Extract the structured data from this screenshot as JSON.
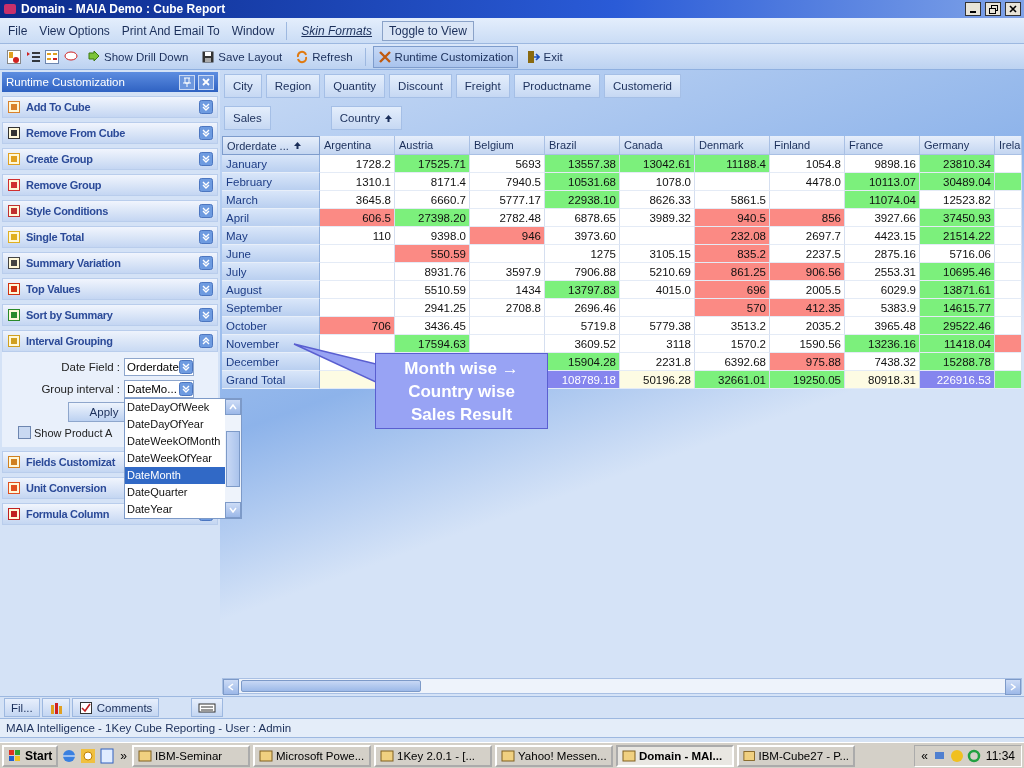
{
  "window": {
    "title": "Domain - MAIA Demo : Cube Report"
  },
  "menu": [
    {
      "label": "File"
    },
    {
      "label": "View Options"
    },
    {
      "label": "Print And Email To"
    },
    {
      "label": "Window"
    }
  ],
  "skin_formats": "Skin Formats",
  "toggle_button": "Toggle to View",
  "toolbar": [
    {
      "label": "Show Drill Down",
      "selected": false
    },
    {
      "label": "Save Layout",
      "selected": false
    },
    {
      "label": "Refresh",
      "selected": false
    },
    {
      "label": "Runtime Customization",
      "selected": true
    },
    {
      "label": "Exit",
      "selected": false
    }
  ],
  "panel": {
    "title": "Runtime Customization",
    "sections": [
      {
        "label": "Add To Cube",
        "expanded": false
      },
      {
        "label": "Remove From Cube",
        "expanded": false
      },
      {
        "label": "Create Group",
        "expanded": false
      },
      {
        "label": "Remove Group",
        "expanded": false
      },
      {
        "label": "Style Conditions",
        "expanded": false
      },
      {
        "label": "Single Total",
        "expanded": false
      },
      {
        "label": "Summary Variation",
        "expanded": false
      },
      {
        "label": "Top Values",
        "expanded": false
      },
      {
        "label": "Sort by Summary",
        "expanded": false
      },
      {
        "label": "Interval Grouping",
        "expanded": true
      },
      {
        "label": "Fields Customizat",
        "expanded": false
      },
      {
        "label": "Unit Conversion",
        "expanded": false
      },
      {
        "label": "Formula Column",
        "expanded": false
      }
    ]
  },
  "interval_grouping": {
    "date_field_label": "Date Field :",
    "date_field_value": "Orderdate",
    "group_interval_label": "Group interval :",
    "group_interval_value": "DateMo...",
    "apply": "Apply",
    "show_product_label": "Show Product A",
    "show_product_checked": false,
    "options": [
      {
        "label": "DateDayOfWeek",
        "selected": false
      },
      {
        "label": "DateDayOfYear",
        "selected": false
      },
      {
        "label": "DateWeekOfMonth",
        "selected": false
      },
      {
        "label": "DateWeekOfYear",
        "selected": false
      },
      {
        "label": "DateMonth",
        "selected": true
      },
      {
        "label": "DateQuarter",
        "selected": false
      },
      {
        "label": "DateYear",
        "selected": false
      }
    ]
  },
  "filter_fields": [
    "City",
    "Region",
    "Quantity",
    "Discount",
    "Freight",
    "Productname",
    "Customerid"
  ],
  "data_field": "Sales",
  "column_field": "Country",
  "row_field": "Orderdate ...",
  "table": {
    "columns": [
      "Argentina",
      "Austria",
      "Belgium",
      "Brazil",
      "Canada",
      "Denmark",
      "Finland",
      "France",
      "Germany",
      "Irela"
    ],
    "rows": [
      {
        "label": "January",
        "cells": [
          {
            "value": "1728.2",
            "color": "#ffffff"
          },
          {
            "value": "17525.71",
            "color": "#7cf07c"
          },
          {
            "value": "5693",
            "color": "#ffffff"
          },
          {
            "value": "13557.38",
            "color": "#7cf07c"
          },
          {
            "value": "13042.61",
            "color": "#7cf07c"
          },
          {
            "value": "11188.4",
            "color": "#7cf07c"
          },
          {
            "value": "1054.8",
            "color": "#ffffff"
          },
          {
            "value": "9898.16",
            "color": "#ffffff"
          },
          {
            "value": "23810.34",
            "color": "#7cf07c"
          },
          {
            "color": "#ffffff"
          }
        ]
      },
      {
        "label": "February",
        "cells": [
          {
            "value": "1310.1",
            "color": "#ffffff"
          },
          {
            "value": "8171.4",
            "color": "#ffffff"
          },
          {
            "value": "7940.5",
            "color": "#ffffff"
          },
          {
            "value": "10531.68",
            "color": "#7cf07c"
          },
          {
            "value": "1078.0",
            "color": "#ffffff"
          },
          {
            "color": "#ffffff"
          },
          {
            "value": "4478.0",
            "color": "#ffffff"
          },
          {
            "value": "10113.07",
            "color": "#7cf07c"
          },
          {
            "value": "30489.04",
            "color": "#7cf07c"
          },
          {
            "color": "#7cf07c"
          }
        ]
      },
      {
        "label": "March",
        "cells": [
          {
            "value": "3645.8",
            "color": "#ffffff"
          },
          {
            "value": "6660.7",
            "color": "#ffffff"
          },
          {
            "value": "5777.17",
            "color": "#ffffff"
          },
          {
            "value": "22938.10",
            "color": "#7cf07c"
          },
          {
            "value": "8626.33",
            "color": "#ffffff"
          },
          {
            "value": "5861.5",
            "color": "#ffffff"
          },
          {
            "color": "#ffffff"
          },
          {
            "value": "11074.04",
            "color": "#7cf07c"
          },
          {
            "value": "12523.82",
            "color": "#ffffff"
          },
          {
            "color": "#ffffff"
          }
        ]
      },
      {
        "label": "April",
        "cells": [
          {
            "value": "606.5",
            "color": "#fb8a84"
          },
          {
            "value": "27398.20",
            "color": "#7cf07c"
          },
          {
            "value": "2782.48",
            "color": "#ffffff"
          },
          {
            "value": "6878.65",
            "color": "#ffffff"
          },
          {
            "value": "3989.32",
            "color": "#ffffff"
          },
          {
            "value": "940.5",
            "color": "#fb8a84"
          },
          {
            "value": "856",
            "color": "#fb8a84"
          },
          {
            "value": "3927.66",
            "color": "#ffffff"
          },
          {
            "value": "37450.93",
            "color": "#7cf07c"
          },
          {
            "color": "#ffffff"
          }
        ]
      },
      {
        "label": "May",
        "cells": [
          {
            "value": "110",
            "color": "#ffffff"
          },
          {
            "value": "9398.0",
            "color": "#ffffff"
          },
          {
            "value": "946",
            "color": "#fb8a84"
          },
          {
            "value": "3973.60",
            "color": "#ffffff"
          },
          {
            "color": "#ffffff"
          },
          {
            "value": "232.08",
            "color": "#fb8a84"
          },
          {
            "value": "2697.7",
            "color": "#ffffff"
          },
          {
            "value": "4423.15",
            "color": "#ffffff"
          },
          {
            "value": "21514.22",
            "color": "#7cf07c"
          },
          {
            "color": "#ffffff"
          }
        ]
      },
      {
        "label": "June",
        "cells": [
          {
            "color": "#ffffff"
          },
          {
            "value": "550.59",
            "color": "#fb8a84"
          },
          {
            "color": "#ffffff"
          },
          {
            "value": "1275",
            "color": "#ffffff"
          },
          {
            "value": "3105.15",
            "color": "#ffffff"
          },
          {
            "value": "835.2",
            "color": "#fb8a84"
          },
          {
            "value": "2237.5",
            "color": "#ffffff"
          },
          {
            "value": "2875.16",
            "color": "#ffffff"
          },
          {
            "value": "5716.06",
            "color": "#ffffff"
          },
          {
            "color": "#ffffff"
          }
        ]
      },
      {
        "label": "July",
        "cells": [
          {
            "color": "#ffffff"
          },
          {
            "value": "8931.76",
            "color": "#ffffff"
          },
          {
            "value": "3597.9",
            "color": "#ffffff"
          },
          {
            "value": "7906.88",
            "color": "#ffffff"
          },
          {
            "value": "5210.69",
            "color": "#ffffff"
          },
          {
            "value": "861.25",
            "color": "#fb8a84"
          },
          {
            "value": "906.56",
            "color": "#fb8a84"
          },
          {
            "value": "2553.31",
            "color": "#ffffff"
          },
          {
            "value": "10695.46",
            "color": "#7cf07c"
          },
          {
            "color": "#ffffff"
          }
        ]
      },
      {
        "label": "August",
        "cells": [
          {
            "color": "#ffffff"
          },
          {
            "value": "5510.59",
            "color": "#ffffff"
          },
          {
            "value": "1434",
            "color": "#ffffff"
          },
          {
            "value": "13797.83",
            "color": "#7cf07c"
          },
          {
            "value": "4015.0",
            "color": "#ffffff"
          },
          {
            "value": "696",
            "color": "#fb8a84"
          },
          {
            "value": "2005.5",
            "color": "#ffffff"
          },
          {
            "value": "6029.9",
            "color": "#ffffff"
          },
          {
            "value": "13871.61",
            "color": "#7cf07c"
          },
          {
            "color": "#ffffff"
          }
        ]
      },
      {
        "label": "September",
        "cells": [
          {
            "color": "#ffffff"
          },
          {
            "value": "2941.25",
            "color": "#ffffff"
          },
          {
            "value": "2708.8",
            "color": "#ffffff"
          },
          {
            "value": "2696.46",
            "color": "#ffffff"
          },
          {
            "color": "#ffffff"
          },
          {
            "value": "570",
            "color": "#fb8a84"
          },
          {
            "value": "412.35",
            "color": "#fb8a84"
          },
          {
            "value": "5383.9",
            "color": "#ffffff"
          },
          {
            "value": "14615.77",
            "color": "#7cf07c"
          },
          {
            "color": "#ffffff"
          }
        ]
      },
      {
        "label": "October",
        "cells": [
          {
            "value": "706",
            "color": "#fb8a84"
          },
          {
            "value": "3436.45",
            "color": "#ffffff"
          },
          {
            "color": "#ffffff"
          },
          {
            "value": "5719.8",
            "color": "#ffffff"
          },
          {
            "value": "5779.38",
            "color": "#ffffff"
          },
          {
            "value": "3513.2",
            "color": "#ffffff"
          },
          {
            "value": "2035.2",
            "color": "#ffffff"
          },
          {
            "value": "3965.48",
            "color": "#ffffff"
          },
          {
            "value": "29522.46",
            "color": "#7cf07c"
          },
          {
            "color": "#ffffff"
          }
        ]
      },
      {
        "label": "November",
        "cells": [
          {
            "color": "#ffffff"
          },
          {
            "value": "17594.63",
            "color": "#7cf07c"
          },
          {
            "color": "#ffffff"
          },
          {
            "value": "3609.52",
            "color": "#ffffff"
          },
          {
            "value": "3118",
            "color": "#ffffff"
          },
          {
            "value": "1570.2",
            "color": "#ffffff"
          },
          {
            "value": "1590.56",
            "color": "#ffffff"
          },
          {
            "value": "13236.16",
            "color": "#7cf07c"
          },
          {
            "value": "11418.04",
            "color": "#7cf07c"
          },
          {
            "color": "#fb8a84"
          }
        ]
      },
      {
        "label": "December",
        "cells": [
          {
            "color": "#ffffff"
          },
          {},
          {},
          {
            "value": "15904.28",
            "color": "#7cf07c"
          },
          {
            "value": "2231.8",
            "color": "#ffffff"
          },
          {
            "value": "6392.68",
            "color": "#ffffff"
          },
          {
            "value": "975.88",
            "color": "#fb8a84"
          },
          {
            "value": "7438.32",
            "color": "#ffffff"
          },
          {
            "value": "15288.78",
            "color": "#7cf07c"
          },
          {
            "color": "#ffffff"
          }
        ]
      },
      {
        "label": "Grand Total",
        "cells": [
          {
            "color": "#fdfbe3"
          },
          {},
          {},
          {
            "value": "108789.18",
            "color": "#8585ee"
          },
          {
            "value": "50196.28",
            "color": "#fdfbe3"
          },
          {
            "value": "32661.01",
            "color": "#7cf07c"
          },
          {
            "value": "19250.05",
            "color": "#7cf07c"
          },
          {
            "value": "80918.31",
            "color": "#fdfbe3"
          },
          {
            "value": "226916.53",
            "color": "#8585ee"
          },
          {
            "color": "#7cf07c"
          }
        ]
      }
    ]
  },
  "callout": {
    "lines": [
      "Month wise →",
      "Country wise",
      "Sales Result"
    ]
  },
  "bottom_tabs": [
    "Fil...",
    "Comments"
  ],
  "status_bar": "MAIA Intelligence - 1Key Cube Reporting - User : Admin",
  "taskbar": {
    "start": "Start",
    "more": "»",
    "tasks": [
      {
        "label": "IBM-Seminar",
        "selected": false
      },
      {
        "label": "Microsoft Powe...",
        "selected": false
      },
      {
        "label": "1Key 2.0.1 - [...",
        "selected": false
      },
      {
        "label": "Yahoo! Messen...",
        "selected": false
      },
      {
        "label": "Domain - MAI...",
        "selected": true
      },
      {
        "label": "IBM-Cube27 - P...",
        "selected": false
      }
    ],
    "tray_toggle": "«",
    "clock": "11:34"
  }
}
